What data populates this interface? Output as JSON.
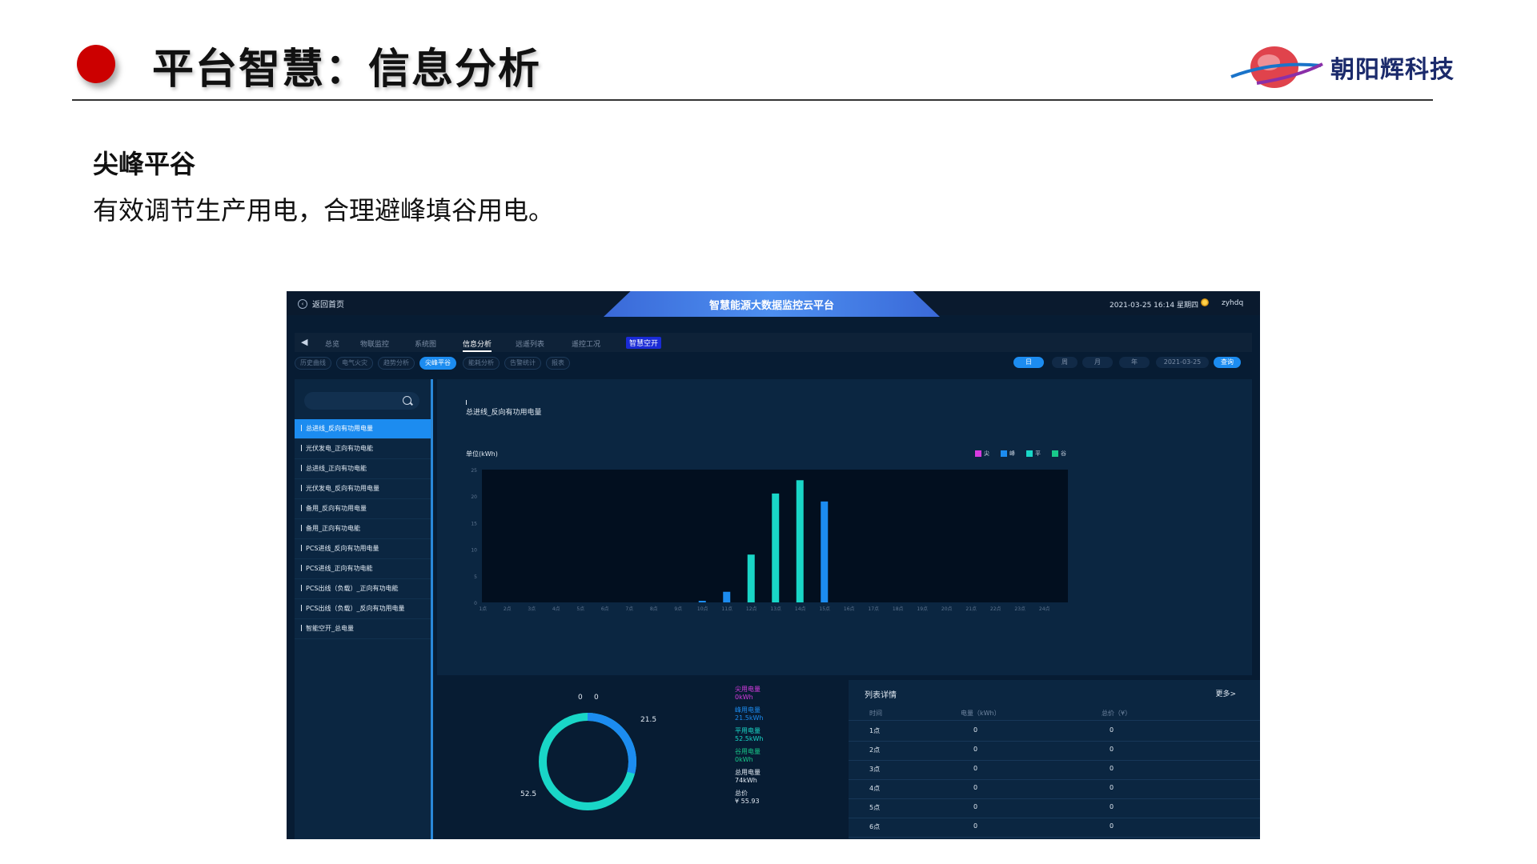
{
  "slide": {
    "title": "平台智慧：信息分析",
    "logo_text": "朝阳辉科技",
    "section_title": "尖峰平谷",
    "section_desc": "有效调节生产用电，合理避峰填谷用电。"
  },
  "dashboard": {
    "back_label": "返回首页",
    "platform_title": "智慧能源大数据监控云平台",
    "datetime": "2021-03-25 16:14 星期四",
    "user": "zyhdq",
    "nav": [
      "总览",
      "物联监控",
      "系统图",
      "信息分析",
      "远遥列表",
      "遥控工况",
      "智慧空开"
    ],
    "subnav": [
      "历史曲线",
      "电气火灾",
      "趋势分析",
      "尖峰平谷",
      "能耗分析",
      "告警统计",
      "报表"
    ],
    "period_buttons": [
      "日",
      "周",
      "月",
      "年"
    ],
    "date_value": "2021-03-25",
    "query_label": "查询",
    "left_list": [
      "总进线_反向有功用电量",
      "光伏发电_正向有功电能",
      "总进线_正向有功电能",
      "光伏发电_反向有功用电量",
      "备用_反向有功用电量",
      "备用_正向有功电能",
      "PCS进线_反向有功用电量",
      "PCS进线_正向有功电能",
      "PCS出线（负载）_正向有功电能",
      "PCS出线（负载）_反向有功用电量",
      "智能空开_总电量"
    ],
    "chart_label": "总进线_反向有功用电量",
    "unit_label": "单位(kWh)",
    "legend": [
      {
        "label": "尖",
        "color": "#d63be0"
      },
      {
        "label": "峰",
        "color": "#1c8cf0"
      },
      {
        "label": "平",
        "color": "#19d6c7"
      },
      {
        "label": "谷",
        "color": "#18c98a"
      }
    ],
    "stats": [
      {
        "label": "尖用电量",
        "value": "0kWh",
        "color": "#d63be0"
      },
      {
        "label": "峰用电量",
        "value": "21.5kWh",
        "color": "#1c8cf0"
      },
      {
        "label": "平用电量",
        "value": "52.5kWh",
        "color": "#19d6c7"
      },
      {
        "label": "谷用电量",
        "value": "0kWh",
        "color": "#18c98a"
      },
      {
        "label": "总用电量",
        "value": "74kWh",
        "color": "#e2eaf3"
      },
      {
        "label": "总价",
        "value": "¥ 55.93",
        "color": "#e2eaf3"
      }
    ],
    "donut_labels": {
      "a": "0",
      "b": "0",
      "peak": "21.5",
      "flat": "52.5"
    },
    "details": {
      "title": "列表详情",
      "more": "更多>",
      "headers": [
        "时间",
        "电量（kWh）",
        "总价（¥）"
      ],
      "rows": [
        [
          "1点",
          "0",
          "0"
        ],
        [
          "2点",
          "0",
          "0"
        ],
        [
          "3点",
          "0",
          "0"
        ],
        [
          "4点",
          "0",
          "0"
        ],
        [
          "5点",
          "0",
          "0"
        ],
        [
          "6点",
          "0",
          "0"
        ]
      ]
    }
  },
  "chart_data": {
    "type": "bar",
    "categories": [
      "1点",
      "2点",
      "3点",
      "4点",
      "5点",
      "6点",
      "7点",
      "8点",
      "9点",
      "10点",
      "11点",
      "12点",
      "13点",
      "14点",
      "15点",
      "16点",
      "17点",
      "18点",
      "19点",
      "20点",
      "21点",
      "22点",
      "23点",
      "24点"
    ],
    "series": [
      {
        "name": "峰",
        "color": "#1c8cf0",
        "values": [
          0,
          0,
          0,
          0,
          0,
          0,
          0,
          0,
          0,
          0.3,
          2,
          0,
          0,
          0,
          19,
          0,
          0,
          0,
          0,
          0,
          0,
          0,
          0,
          0
        ]
      },
      {
        "name": "平",
        "color": "#19d6c7",
        "values": [
          0,
          0,
          0,
          0,
          0,
          0,
          0,
          0,
          0,
          0,
          0,
          9,
          20.5,
          23,
          0,
          0,
          0,
          0,
          0,
          0,
          0,
          0,
          0,
          0
        ]
      }
    ],
    "yticks": [
      0,
      5,
      10,
      15,
      20,
      25
    ],
    "ylim": [
      0,
      25
    ],
    "ylabel": "单位(kWh)",
    "grid": false
  }
}
